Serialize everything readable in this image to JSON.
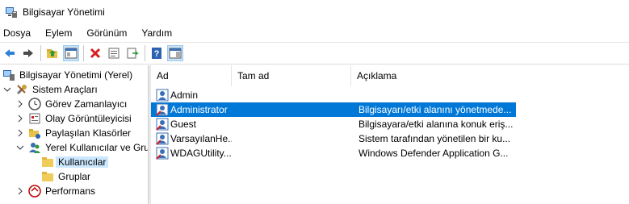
{
  "window": {
    "title": "Bilgisayar Yönetimi"
  },
  "menu": [
    "Dosya",
    "Eylem",
    "Görünüm",
    "Yardım"
  ],
  "toolbar": {
    "buttons": [
      "back-icon",
      "forward-icon",
      "up-folder-icon",
      "show-hide-tree-icon",
      "delete-icon",
      "properties-icon",
      "export-list-icon",
      "help-icon",
      "action-pane-icon"
    ]
  },
  "tree": {
    "root": "Bilgisayar Yönetimi (Yerel)",
    "system_tools": "Sistem Araçları",
    "task_scheduler": "Görev Zamanlayıcı",
    "event_viewer": "Olay Görüntüleyicisi",
    "shared_folders": "Paylaşılan Klasörler",
    "local_users_groups": "Yerel Kullanıcılar ve Gru",
    "users": "Kullanıcılar",
    "groups": "Gruplar",
    "performance": "Performans"
  },
  "list": {
    "headers": {
      "name": "Ad",
      "full_name": "Tam ad",
      "description": "Açıklama"
    },
    "rows": [
      {
        "name": "Admin",
        "full_name": "",
        "description": ""
      },
      {
        "name": "Administrator",
        "full_name": "",
        "description": "Bilgisayarı/etki alanını yönetmede..."
      },
      {
        "name": "Guest",
        "full_name": "",
        "description": "Bilgisayara/etki alanına konuk eriş..."
      },
      {
        "name": "VarsayılanHe...",
        "full_name": "",
        "description": "Sistem tarafından yönetilen bir ku..."
      },
      {
        "name": "WDAGUtility...",
        "full_name": "",
        "description": "Windows Defender Application G..."
      }
    ],
    "selected_index": 1
  },
  "colors": {
    "selection": "#0078d7",
    "tree_selection": "#cce8ff",
    "accent": "#0078d7"
  }
}
